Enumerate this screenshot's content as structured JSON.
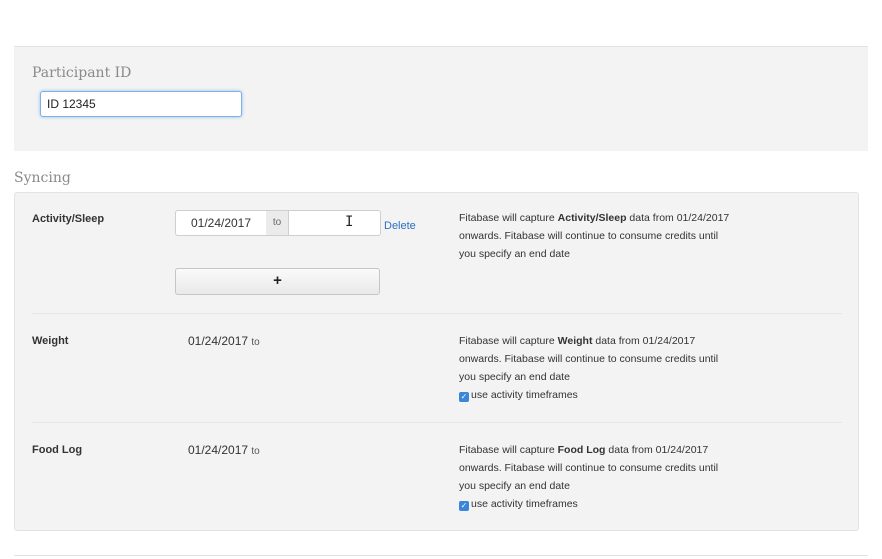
{
  "participant": {
    "label": "Participant ID",
    "value": "ID 12345"
  },
  "syncing": {
    "heading": "Syncing",
    "rows": [
      {
        "label": "Activity/Sleep",
        "start_date": "01/24/2017",
        "to_label": "to",
        "end_date": "",
        "delete_label": "Delete",
        "add_label": "+",
        "desc_pre": "Fitabase will capture ",
        "desc_bold": "Activity/Sleep",
        "desc_post": " data from 01/24/2017 onwards. Fitabase will continue to consume credits until you specify an end date"
      },
      {
        "label": "Weight",
        "start_date": "01/24/2017",
        "to_label": "to",
        "desc_pre": "Fitabase will capture ",
        "desc_bold": "Weight",
        "desc_post": " data from 01/24/2017 onwards. Fitabase will continue to consume credits until you specify an end date",
        "checkbox_label": "use activity timeframes",
        "checked": true
      },
      {
        "label": "Food Log",
        "start_date": "01/24/2017",
        "to_label": "to",
        "desc_pre": "Fitabase will capture ",
        "desc_bold": "Food Log",
        "desc_post": " data from 01/24/2017 onwards. Fitabase will continue to consume credits until you specify an end date",
        "checkbox_label": "use activity timeframes",
        "checked": true
      }
    ]
  },
  "icons": {
    "text_cursor": "I-beam-cursor-icon",
    "check": "checkmark-icon"
  },
  "colors": {
    "link": "#2a6fc0",
    "checkbox": "#3b86d8",
    "focus_border": "#7fb0e6",
    "panel_bg": "#f3f3f3"
  }
}
